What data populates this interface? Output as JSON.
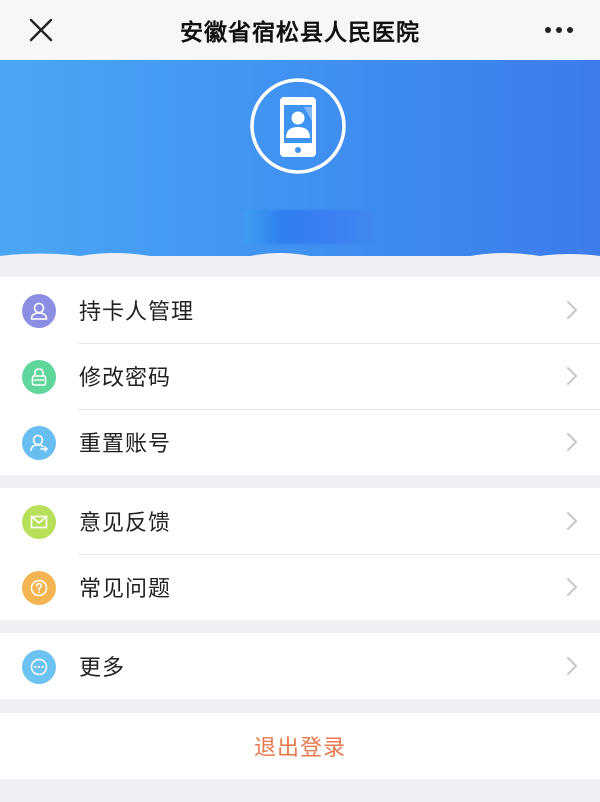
{
  "app": {
    "title": "安徽省宿松县人民医院"
  },
  "icons": {
    "close": "close-icon",
    "more": "more-dots-icon",
    "avatar": "phone-user-icon",
    "chevron": "chevron-right-icon"
  },
  "colors": {
    "hero_start": "#4ba7f5",
    "hero_end": "#3c7ceb",
    "logout_text": "#e8794d"
  },
  "menu": {
    "group1": [
      {
        "label": "持卡人管理",
        "icon": "user-icon",
        "color": "#8c8ee3"
      },
      {
        "label": "修改密码",
        "icon": "lock-icon",
        "color": "#5fd69b"
      },
      {
        "label": "重置账号",
        "icon": "user-reset-icon",
        "color": "#68bdf1"
      }
    ],
    "group2": [
      {
        "label": "意见反馈",
        "icon": "mail-icon",
        "color": "#b9e05a"
      },
      {
        "label": "常见问题",
        "icon": "question-icon",
        "color": "#f2b552"
      }
    ],
    "group3": [
      {
        "label": "更多",
        "icon": "more-circle-icon",
        "color": "#6cc2f0"
      }
    ]
  },
  "logout": {
    "label": "退出登录"
  }
}
